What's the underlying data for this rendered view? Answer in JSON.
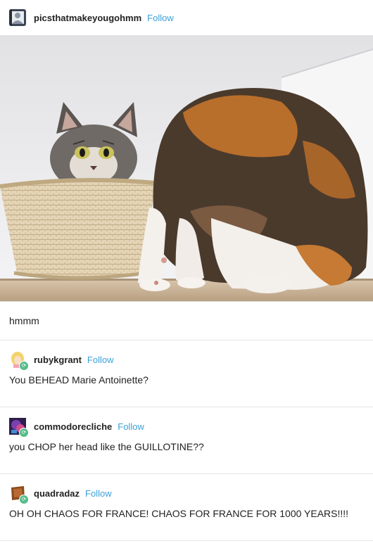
{
  "post": {
    "username": "picsthatmakeyougohmm",
    "follow_label": "Follow",
    "avatar_icon": "person-avatar-icon",
    "caption": "hmmm"
  },
  "reblogs": [
    {
      "username": "rubykgrant",
      "follow_label": "Follow",
      "text": "You BEHEAD  Marie Antoinette?",
      "avatar_color": "#f3d36b"
    },
    {
      "username": "commodorecliche",
      "follow_label": "Follow",
      "text": "you CHOP her head like the GUILLOTINE??",
      "avatar_color": "#7a3fb0"
    },
    {
      "username": "quadradaz",
      "follow_label": "Follow",
      "text": "OH OH CHAOS FOR FRANCE! CHAOS FOR FRANCE FOR 1000 YEARS!!!!",
      "avatar_color": "#8b4a1e"
    }
  ],
  "colors": {
    "link_blue": "#3aa0d8",
    "reblog_green": "#56bc8a"
  }
}
